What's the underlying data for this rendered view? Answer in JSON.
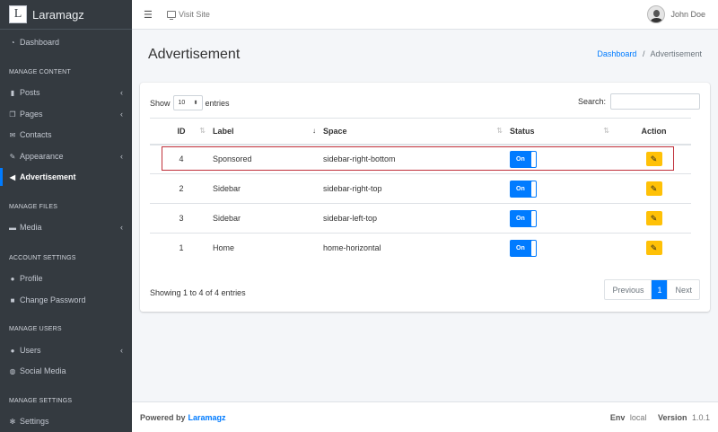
{
  "brand": {
    "logo_letter": "L",
    "name": "Laramagz"
  },
  "sidebar": {
    "dashboard": "Dashboard",
    "headers": [
      "MANAGE CONTENT",
      "MANAGE FILES",
      "ACCOUNT SETTINGS",
      "MANAGE USERS",
      "MANAGE SETTINGS"
    ],
    "items": [
      {
        "label": "Posts",
        "icon": "file-icon",
        "chevron": "‹"
      },
      {
        "label": "Pages",
        "icon": "pages-icon",
        "chevron": "‹"
      },
      {
        "label": "Contacts",
        "icon": "envelope-icon"
      },
      {
        "label": "Appearance",
        "icon": "paint-brush-icon",
        "chevron": "‹"
      },
      {
        "label": "Advertisement",
        "icon": "bullhorn-icon",
        "active": true
      },
      {
        "label": "Media",
        "icon": "images-icon",
        "chevron": "‹"
      },
      {
        "label": "Profile",
        "icon": "user-icon"
      },
      {
        "label": "Change Password",
        "icon": "lock-icon"
      },
      {
        "label": "Users",
        "icon": "users-icon",
        "chevron": "‹"
      },
      {
        "label": "Social Media",
        "icon": "globe-icon"
      },
      {
        "label": "Settings",
        "icon": "cogs-icon"
      }
    ]
  },
  "topbar": {
    "visit_label": "Visit Site",
    "user_name": "John Doe"
  },
  "page": {
    "title": "Advertisement",
    "breadcrumb_home": "Dashboard",
    "breadcrumb_sep": "/",
    "breadcrumb_current": "Advertisement"
  },
  "table": {
    "show_label": "Show",
    "show_value": "10",
    "entries_label": "entries",
    "search_label": "Search:",
    "search_value": "",
    "columns": [
      "ID",
      "Label",
      "Space",
      "Status",
      "Action"
    ],
    "rows": [
      {
        "id": "4",
        "label": "Sponsored",
        "space": "sidebar-right-bottom",
        "status": "On"
      },
      {
        "id": "2",
        "label": "Sidebar",
        "space": "sidebar-right-top",
        "status": "On"
      },
      {
        "id": "3",
        "label": "Sidebar",
        "space": "sidebar-left-top",
        "status": "On"
      },
      {
        "id": "1",
        "label": "Home",
        "space": "home-horizontal",
        "status": "On"
      }
    ],
    "info": "Showing 1 to 4 of 4 entries",
    "pager": {
      "prev": "Previous",
      "current": "1",
      "next": "Next"
    }
  },
  "footer": {
    "powered": "Powered by",
    "brand": "Laramagz",
    "env_label": "Env",
    "env_value": "local",
    "version_label": "Version",
    "version_value": "1.0.1"
  },
  "colors": {
    "accent": "#007bff",
    "sidebar_bg": "#343a40",
    "edit_button": "#ffc107",
    "highlight": "#c0303a"
  }
}
